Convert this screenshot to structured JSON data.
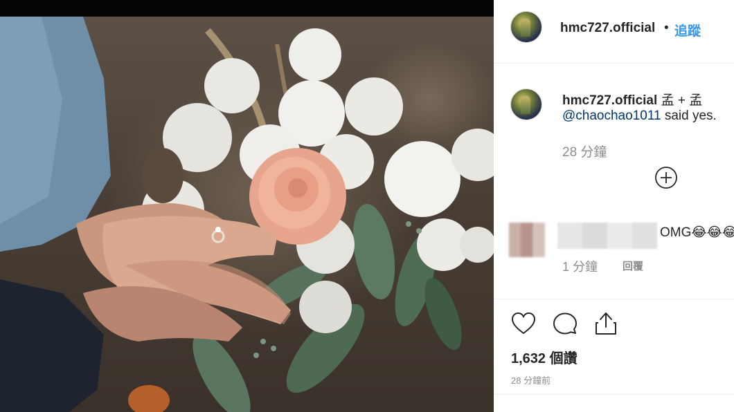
{
  "post": {
    "username": "hmc727.official",
    "follow_label": "追蹤",
    "separator": "•"
  },
  "caption": {
    "username": "hmc727.official",
    "text_part1": "孟 + 孟",
    "mention": "@chaochao1011",
    "text_part2": "said yes.",
    "time": "28 分鐘"
  },
  "comment": {
    "text": "OMG😂😂😂",
    "time": "1 分鐘",
    "reply_label": "回覆"
  },
  "stats": {
    "likes": "1,632 個讚",
    "posted": "28 分鐘前"
  },
  "icons": {
    "like": "heart-icon",
    "comment": "comment-bubble-icon",
    "share": "share-icon",
    "load_more": "plus-circle-icon"
  },
  "colors": {
    "follow": "#3897f0",
    "mention": "#003569",
    "muted": "#8e8e8e",
    "text": "#262626"
  }
}
